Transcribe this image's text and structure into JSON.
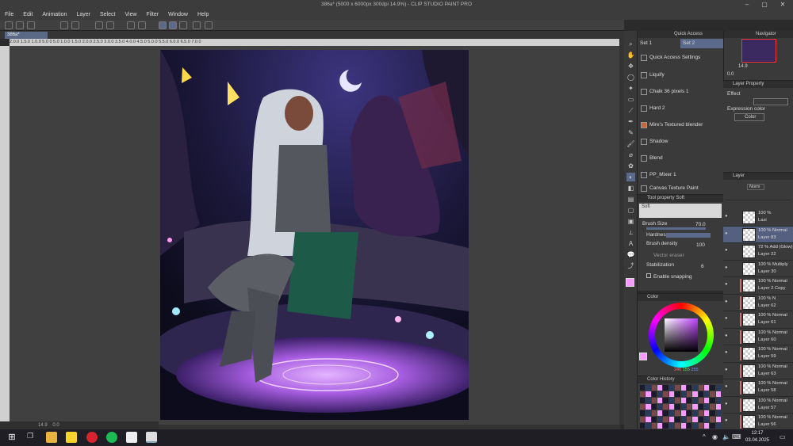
{
  "window": {
    "title": "386a* (5000 x 6000px 300dpi 14.9%) - CLIP STUDIO PAINT PRO"
  },
  "menu": [
    "File",
    "Edit",
    "Animation",
    "Layer",
    "Select",
    "View",
    "Filter",
    "Window",
    "Help"
  ],
  "document": {
    "tab": "386a*",
    "zoom": "14.9",
    "angle": "0.0"
  },
  "ruler_labels": [
    "2.0.0",
    "1.5.0",
    "1.0.0",
    "5.0",
    "0",
    "5.0",
    "1.0.0",
    "1.5.0",
    "2.0.0",
    "2.5.0",
    "3.0.0",
    "3.5.0",
    "4.0.0",
    "4.5.0",
    "5.0.0",
    "5.5.0",
    "6.0.0",
    "6.5.0",
    "7.0.0"
  ],
  "quick_access": {
    "title": "Quick Access",
    "set1": "Set 1",
    "set2": "Set 2",
    "settings": "Quick Access Settings",
    "items": [
      "Liquify",
      "Chalk 36 pixels 1",
      "Hard 2",
      "Mire's Textured blender",
      "Shadow",
      "Blend",
      "PP_Mixer 1",
      "Canvas Texture Paint"
    ]
  },
  "tool_property": {
    "title": "Tool property",
    "tool": "Soft",
    "preview_label": "Soft",
    "brush_size_label": "Brush Size",
    "brush_size": "70.0",
    "hardness_label": "Hardness",
    "density_label": "Brush density",
    "density": "100",
    "vector_eraser": "Vector eraser",
    "stabilization_label": "Stabilization",
    "stabilization": "6",
    "snapping": "Enable snapping"
  },
  "color": {
    "title": "Color",
    "r": "246",
    "g": "155",
    "b": "255",
    "swatch": "#f69bff"
  },
  "history": {
    "title": "Color History"
  },
  "navigator": {
    "title": "Navigator",
    "zoom": "14.9",
    "angle": "0.0"
  },
  "layer_property": {
    "title": "Layer Property",
    "effect_label": "Effect",
    "expression_label": "Expression color",
    "expression_value": "Color"
  },
  "layer_panel": {
    "title": "Layer",
    "blend": "Norm",
    "layers": [
      {
        "l1": "100 %",
        "l2": "Lasi"
      },
      {
        "l1": "100 % Normal",
        "l2": "Layer 83"
      },
      {
        "l1": "72 % Add (Glow)",
        "l2": "Layer 22"
      },
      {
        "l1": "100 % Multiply",
        "l2": "Layer 30"
      },
      {
        "l1": "100 % Normal",
        "l2": "Layer 2 Copy"
      },
      {
        "l1": "100 % N",
        "l2": "Layer 62"
      },
      {
        "l1": "100 % Normal",
        "l2": "Layer 61"
      },
      {
        "l1": "100 % Normal",
        "l2": "Layer 60"
      },
      {
        "l1": "100 % Normal",
        "l2": "Layer 59"
      },
      {
        "l1": "100 % Normal",
        "l2": "Layer 63"
      },
      {
        "l1": "100 % Normal",
        "l2": "Layer 58"
      },
      {
        "l1": "100 % Normal",
        "l2": "Layer 57"
      },
      {
        "l1": "100 % Normal",
        "l2": "Layer 56"
      }
    ]
  },
  "taskbar": {
    "time": "12:17",
    "date": "03.04.2025"
  }
}
